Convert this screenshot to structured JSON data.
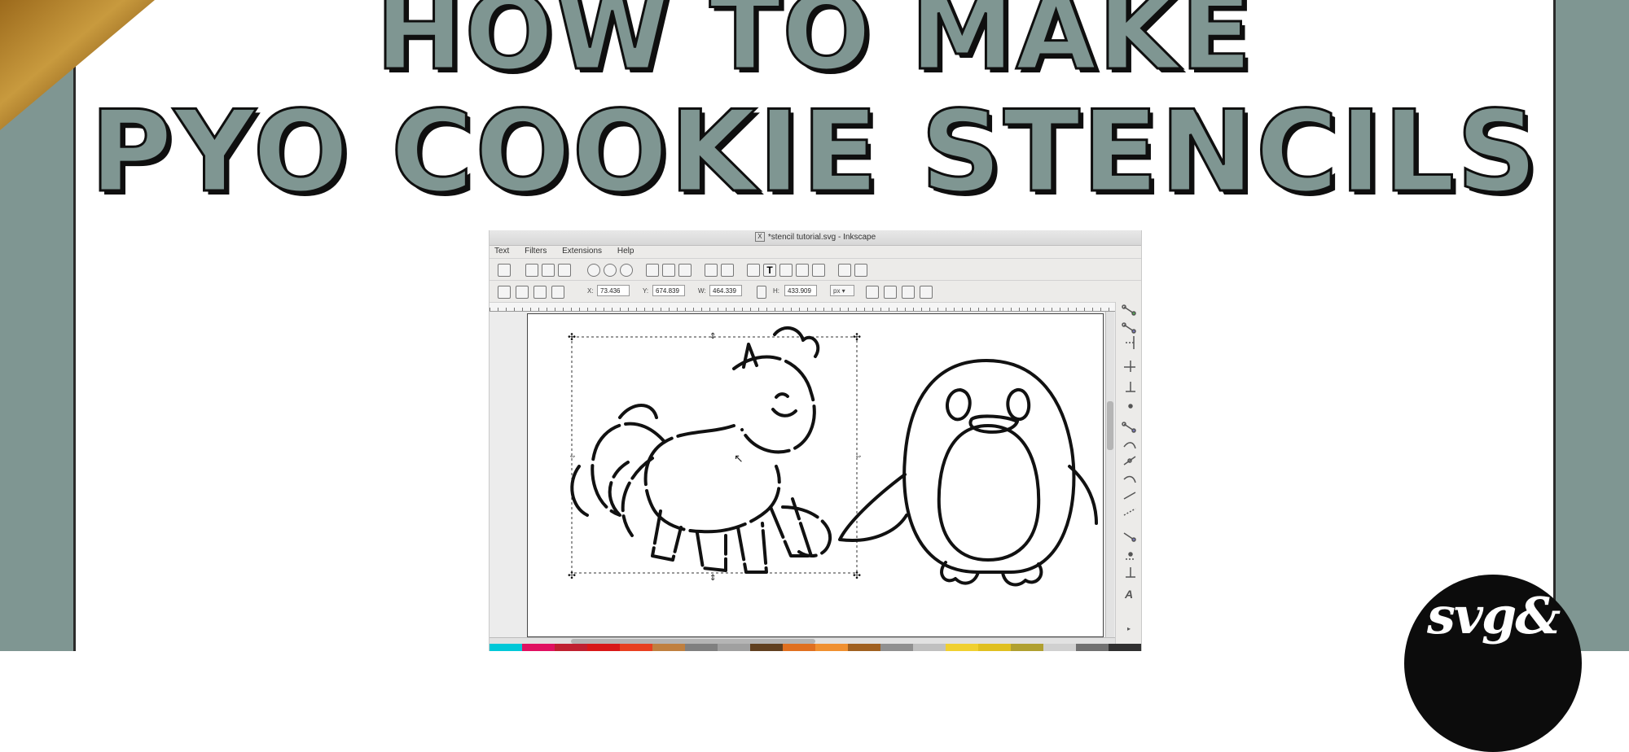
{
  "headline": {
    "line1": "HOW TO MAKE",
    "line2": "PYO COOKIE STENCILS"
  },
  "window": {
    "title": "*stencil tutorial.svg - Inkscape",
    "menu": [
      "Text",
      "Filters",
      "Extensions",
      "Help"
    ],
    "tool_controls": {
      "x_label": "X:",
      "x_value": "73.436",
      "y_label": "Y:",
      "y_value": "674.839",
      "w_label": "W:",
      "w_value": "464.339",
      "h_label": "H:",
      "h_value": "433.909",
      "unit": "px"
    }
  },
  "canvas": {
    "objects": [
      "unicorn-drawing",
      "penguin-drawing"
    ]
  },
  "logo": {
    "text": "svg&"
  },
  "colors": {
    "frame": "#7f9692",
    "title_fill": "#7f9692",
    "title_outline": "#0f0f0f",
    "logo_bg": "#0c0c0c"
  },
  "palette": [
    "#00c8d8",
    "#e01060",
    "#c02030",
    "#d81818",
    "#e84020",
    "#c08040",
    "#808080",
    "#a0a0a0",
    "#604020",
    "#e07020",
    "#f09030",
    "#a06020",
    "#909090",
    "#c0c0c0",
    "#f0d030",
    "#e0c020",
    "#b0a030",
    "#d0d0d0",
    "#707070",
    "#303030"
  ]
}
